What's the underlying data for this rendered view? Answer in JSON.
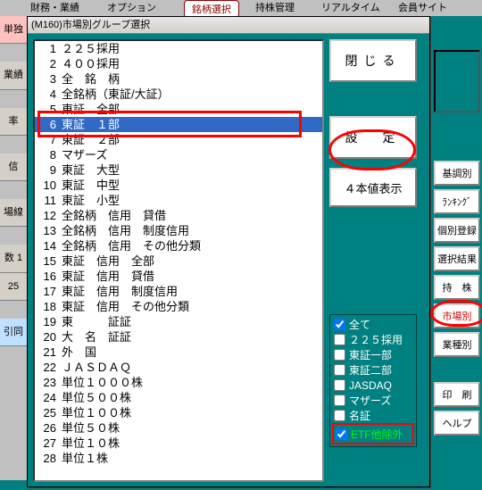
{
  "bg": {
    "tab_red": "銘柄選択",
    "menu_hints": [
      "財務・業績",
      "オプション",
      "持株管理",
      "リアルタイム",
      "会員サイト"
    ],
    "left_buttons": [
      "単独",
      "業績",
      "率",
      "信",
      "場線",
      "数 1",
      "25",
      "引同"
    ]
  },
  "window": {
    "title": "(M160)市場別グループ選択"
  },
  "list": {
    "selected_index": 5,
    "items": [
      {
        "n": "1",
        "t": "２２５採用"
      },
      {
        "n": "2",
        "t": "４００採用"
      },
      {
        "n": "3",
        "t": "全　銘　柄"
      },
      {
        "n": "4",
        "t": "全銘柄（東証/大証）"
      },
      {
        "n": "5",
        "t": "東証　全部"
      },
      {
        "n": "6",
        "t": "東証　１部"
      },
      {
        "n": "7",
        "t": "東証　２部"
      },
      {
        "n": "8",
        "t": "マザーズ"
      },
      {
        "n": "9",
        "t": "東証　大型"
      },
      {
        "n": "10",
        "t": "東証　中型"
      },
      {
        "n": "11",
        "t": "東証　小型"
      },
      {
        "n": "12",
        "t": "全銘柄　信用　貸借"
      },
      {
        "n": "13",
        "t": "全銘柄　信用　制度信用"
      },
      {
        "n": "14",
        "t": "全銘柄　信用　その他分類"
      },
      {
        "n": "15",
        "t": "東証　信用　全部"
      },
      {
        "n": "16",
        "t": "東証　信用　貸借"
      },
      {
        "n": "17",
        "t": "東証　信用　制度信用"
      },
      {
        "n": "18",
        "t": "東証　信用　その他分類"
      },
      {
        "n": "19",
        "t": "東　　　証証"
      },
      {
        "n": "20",
        "t": "大　名　証証"
      },
      {
        "n": "21",
        "t": "外　国"
      },
      {
        "n": "22",
        "t": "ＪＡＳＤＡＱ"
      },
      {
        "n": "23",
        "t": "単位１０００株"
      },
      {
        "n": "24",
        "t": "単位５００株"
      },
      {
        "n": "25",
        "t": "単位１００株"
      },
      {
        "n": "26",
        "t": "単位５０株"
      },
      {
        "n": "27",
        "t": "単位１０株"
      },
      {
        "n": "28",
        "t": "単位１株"
      }
    ]
  },
  "buttons": {
    "close": "閉じる",
    "set": "設　定",
    "ohlc": "４本値表示"
  },
  "filters": [
    {
      "label": "全て",
      "checked": true
    },
    {
      "label": "２２５採用",
      "checked": false
    },
    {
      "label": "東証一部",
      "checked": false
    },
    {
      "label": "東証二部",
      "checked": false
    },
    {
      "label": "JASDAQ",
      "checked": false
    },
    {
      "label": "マザーズ",
      "checked": false
    },
    {
      "label": "名証",
      "checked": false
    },
    {
      "label": "ETF他除外",
      "checked": true
    }
  ],
  "side": {
    "buttons": [
      "基調別",
      "ﾗﾝｷﾝｸﾞ",
      "個別登録",
      "選択結果",
      "持　株",
      "市場別",
      "業種別"
    ],
    "footer": [
      "印　刷",
      "ヘルプ"
    ]
  }
}
